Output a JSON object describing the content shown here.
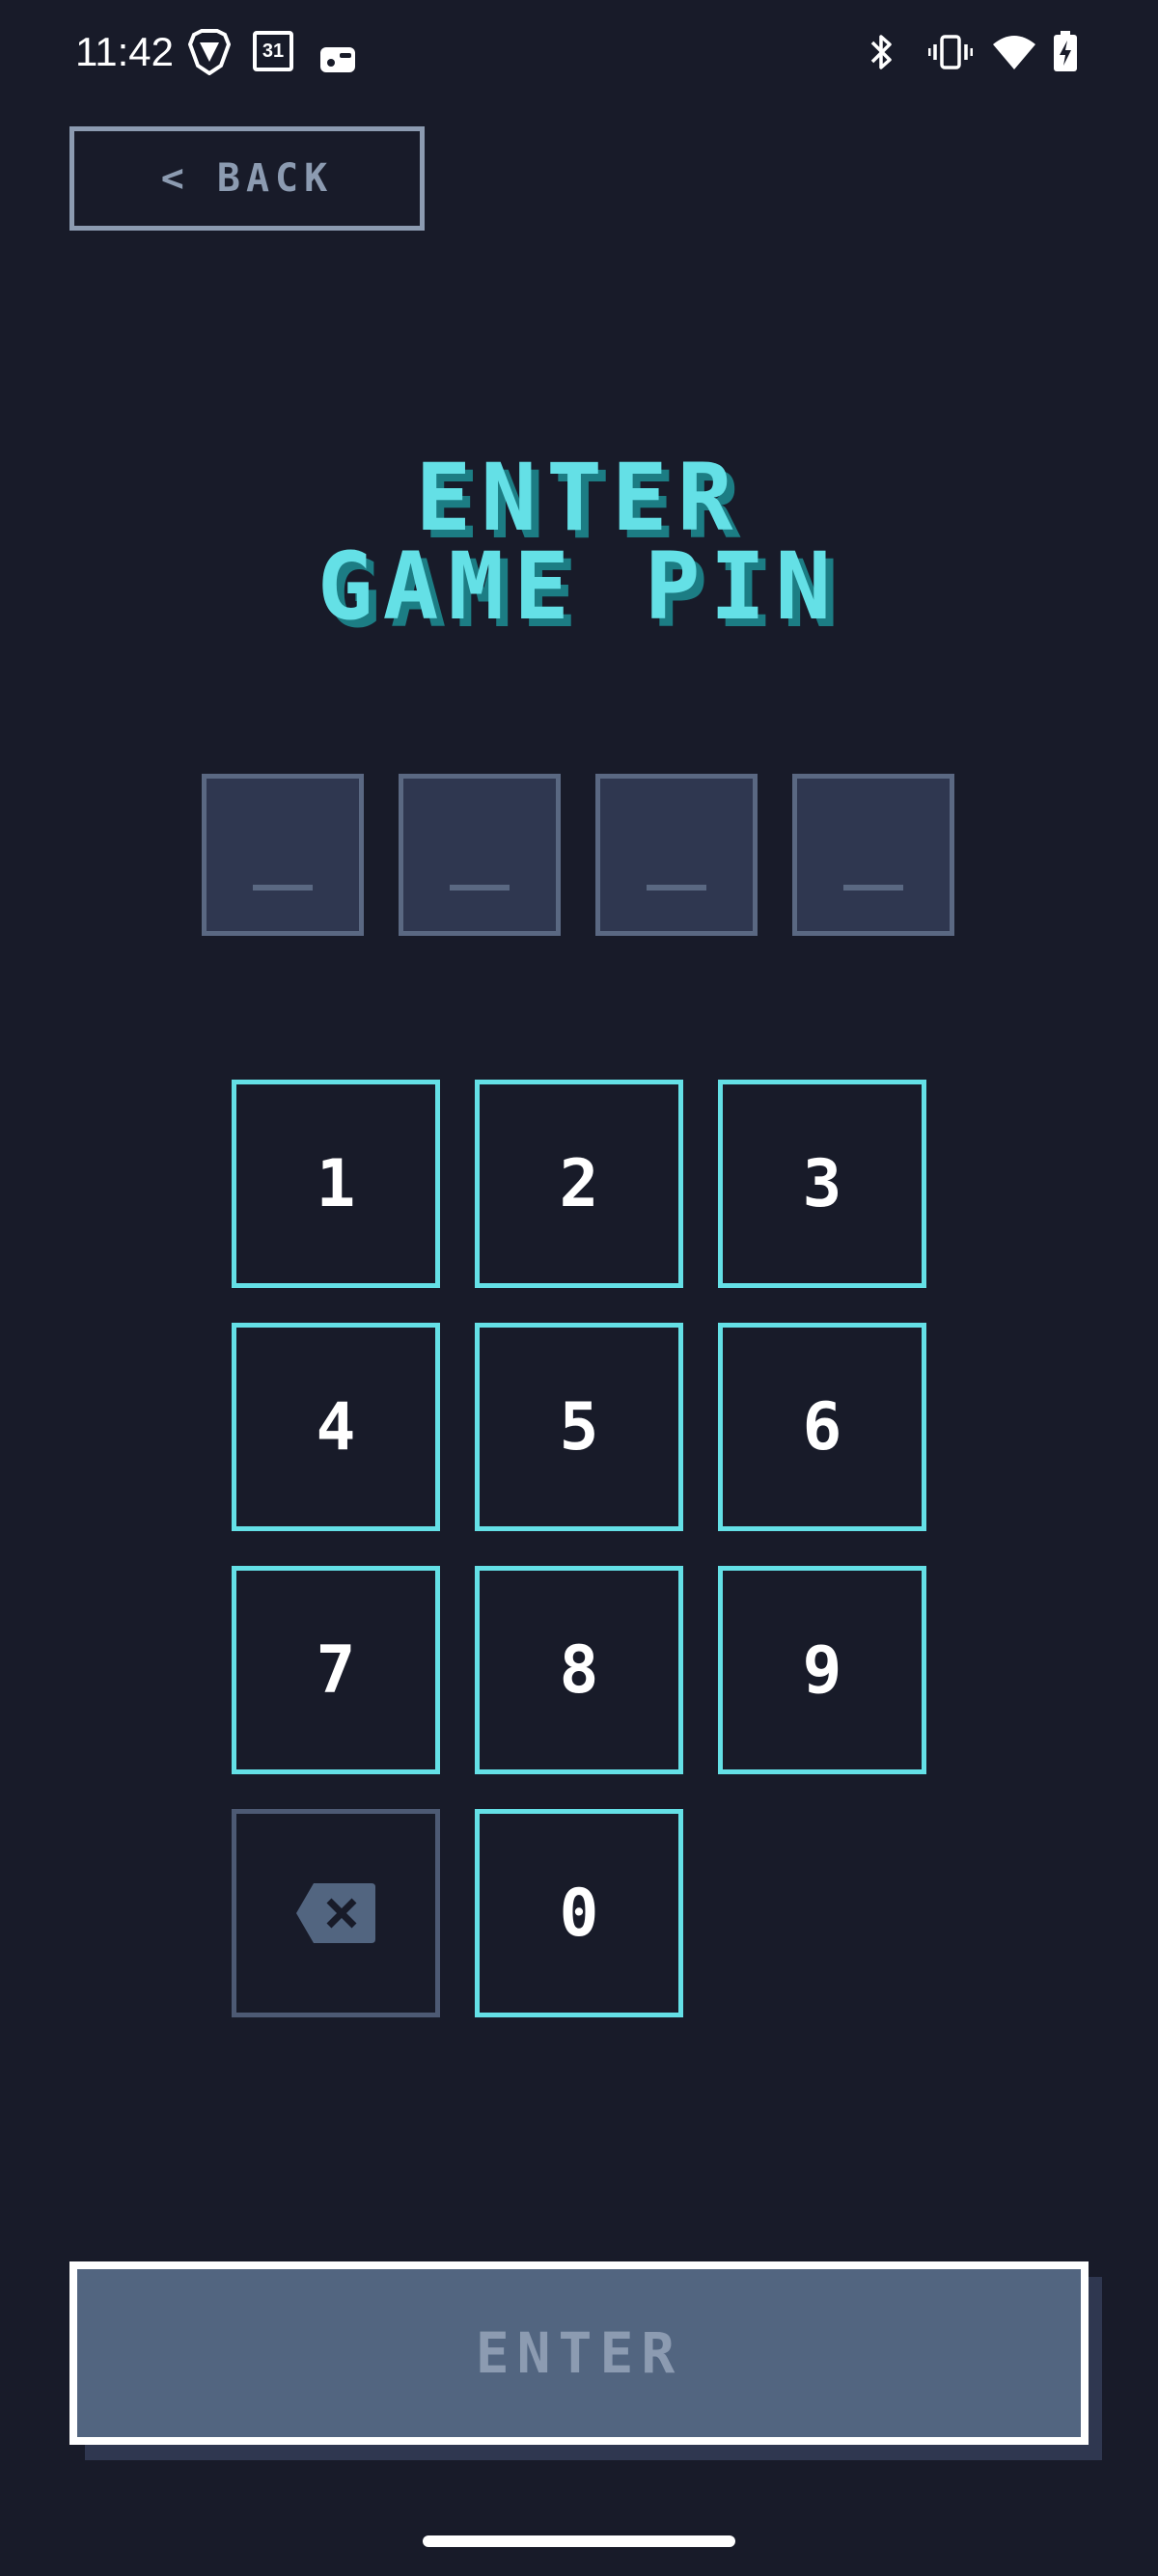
{
  "status_bar": {
    "time": "11:42",
    "calendar_day": "31",
    "icons": [
      "brave-icon",
      "calendar-icon",
      "game-controller-icon",
      "bluetooth-icon",
      "vibrate-icon",
      "wifi-icon",
      "battery-charging-icon"
    ]
  },
  "back_button": {
    "chevron": "<",
    "label": "BACK"
  },
  "title": {
    "line1": "ENTER",
    "line2": "GAME PIN"
  },
  "pin_slots": [
    "_",
    "_",
    "_",
    "_"
  ],
  "keypad": {
    "keys": [
      "1",
      "2",
      "3",
      "4",
      "5",
      "6",
      "7",
      "8",
      "9",
      "0"
    ],
    "backspace_icon": "backspace-icon"
  },
  "enter_button": {
    "label": "ENTER"
  },
  "colors": {
    "background": "#181b29",
    "accent": "#64e0e6",
    "accent_shadow": "#1c7d84",
    "muted": "#8c9bb1",
    "slot_fill": "#2f3750",
    "slot_border": "#5a6882",
    "enter_fill": "#526580"
  }
}
